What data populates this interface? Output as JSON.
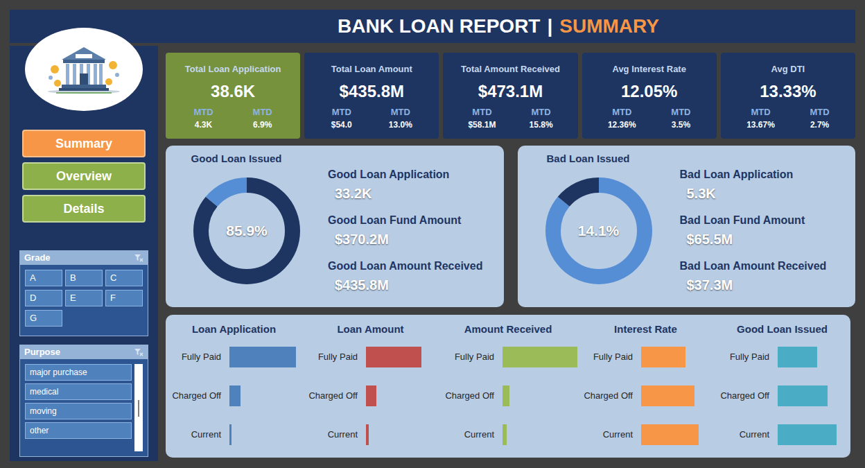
{
  "header": {
    "title": "BANK LOAN REPORT",
    "separator": "|",
    "subtitle": "SUMMARY"
  },
  "nav": [
    {
      "label": "Summary",
      "selected": true
    },
    {
      "label": "Overview",
      "selected": false
    },
    {
      "label": "Details",
      "selected": false
    }
  ],
  "slicers": [
    {
      "title": "Grade",
      "kind": "grid",
      "items": [
        "A",
        "B",
        "C",
        "D",
        "E",
        "F",
        "G"
      ]
    },
    {
      "title": "Purpose",
      "kind": "list",
      "items": [
        "major purchase",
        "medical",
        "moving",
        "other"
      ]
    }
  ],
  "kpis": [
    {
      "title": "Total Loan Application",
      "value": "38.6K",
      "highlighted": true,
      "subs": [
        {
          "label": "MTD",
          "value": "4.3K"
        },
        {
          "label": "MTD",
          "value": "6.9%"
        }
      ]
    },
    {
      "title": "Total Loan Amount",
      "value": "$435.8M",
      "highlighted": false,
      "subs": [
        {
          "label": "MTD",
          "value": "$54.0"
        },
        {
          "label": "MTD",
          "value": "13.0%"
        }
      ]
    },
    {
      "title": "Total Amount Received",
      "value": "$473.1M",
      "highlighted": false,
      "subs": [
        {
          "label": "MTD",
          "value": "$58.1M"
        },
        {
          "label": "MTD",
          "value": "15.8%"
        }
      ]
    },
    {
      "title": "Avg Interest Rate",
      "value": "12.05%",
      "highlighted": false,
      "subs": [
        {
          "label": "MTD",
          "value": "12.36%"
        },
        {
          "label": "MTD",
          "value": "3.5%"
        }
      ]
    },
    {
      "title": "Avg DTI",
      "value": "13.33%",
      "highlighted": false,
      "subs": [
        {
          "label": "MTD",
          "value": "13.67%"
        },
        {
          "label": "MTD",
          "value": "2.7%"
        }
      ]
    }
  ],
  "issued": [
    {
      "title": "Good Loan Issued",
      "share": "85.9%",
      "segments": [
        {
          "share": 0.859,
          "color": "#1e3461"
        },
        {
          "share": 0.141,
          "color": "#558ed5"
        }
      ],
      "stats": [
        {
          "label": "Good Loan Application",
          "value": "33.2K"
        },
        {
          "label": "Good Loan Fund Amount",
          "value": "$370.2M"
        },
        {
          "label": "Good Loan Amount Received",
          "value": "$435.8M"
        }
      ]
    },
    {
      "title": "Bad Loan Issued",
      "share": "14.1%",
      "segments": [
        {
          "share": 0.859,
          "color": "#558ed5"
        },
        {
          "share": 0.141,
          "color": "#1e3461"
        }
      ],
      "stats": [
        {
          "label": "Bad Loan Application",
          "value": "5.3K"
        },
        {
          "label": "Bad Loan Fund Amount",
          "value": "$65.5M"
        },
        {
          "label": "Bad Loan Amount Received",
          "value": "$37.3M"
        }
      ]
    }
  ],
  "charts": [
    {
      "title": "Loan Application",
      "color": "#4f81bd",
      "categories": [
        "Fully Paid",
        "Charged Off",
        "Current"
      ],
      "values": [
        32145,
        5333,
        1098
      ]
    },
    {
      "title": "Loan Amount",
      "color": "#c0504d",
      "categories": [
        "Fully Paid",
        "Charged Off",
        "Current"
      ],
      "values": [
        351.4,
        65.5,
        18.9
      ]
    },
    {
      "title": "Amount Received",
      "color": "#9bbb59",
      "categories": [
        "Fully Paid",
        "Charged Off",
        "Current"
      ],
      "values": [
        411.6,
        37.3,
        24.2
      ]
    },
    {
      "title": "Interest Rate",
      "color": "#f79646",
      "categories": [
        "Fully Paid",
        "Charged Off",
        "Current"
      ],
      "values": [
        11.64,
        13.88,
        15.03
      ]
    },
    {
      "title": "Good Loan Issued",
      "color": "#4bacc6",
      "categories": [
        "Fully Paid",
        "Charged Off",
        "Current"
      ],
      "values": [
        8.6,
        10.9,
        12.9
      ]
    }
  ]
}
